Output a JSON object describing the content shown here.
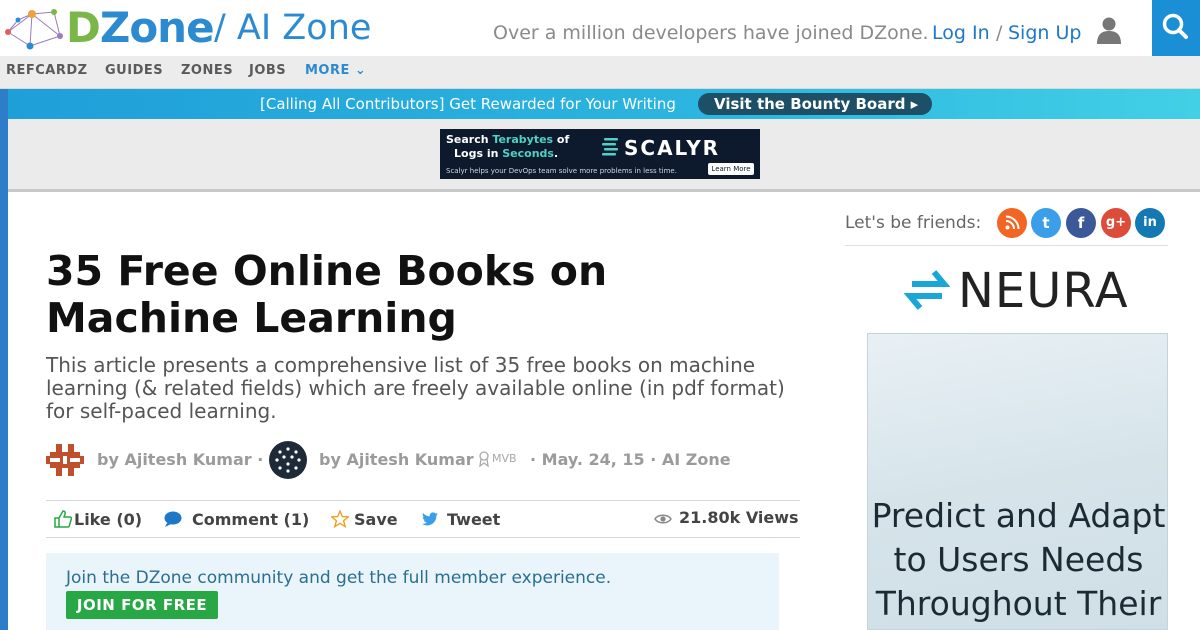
{
  "header": {
    "logo_text_d": "D",
    "logo_text_rest": "Zone",
    "zone_title": "/ AI Zone",
    "tagline": "Over a million developers have joined DZone.",
    "login": "Log In",
    "separator": "/",
    "signup": "Sign Up"
  },
  "nav": {
    "items": [
      "REFCARDZ",
      "GUIDES",
      "ZONES",
      "JOBS"
    ],
    "more": "MORE ⌄"
  },
  "banner": {
    "text": "[Calling All Contributors] Get Rewarded for Your Writing",
    "button": "Visit the Bounty Board ▸"
  },
  "top_ad": {
    "line1_a": "Search ",
    "line1_b": "Terabytes",
    "line1_c": " of",
    "line2_a": "Logs in ",
    "line2_b": "Seconds",
    "line2_c": ".",
    "brand": "SCALYR",
    "footer": "Scalyr helps your DevOps team solve more problems in less time.",
    "cta": "Learn More"
  },
  "article": {
    "title": "35 Free Online Books on Machine Learning",
    "subtitle": "This article presents a comprehensive list of 35 free books on machine learning (& related fields) which are freely available online (in pdf format) for self-paced learning.",
    "author1": "by Ajitesh Kumar ·",
    "author2": "by Ajitesh Kumar",
    "badge": "MVB",
    "date_zone": "·  May. 24, 15 · AI Zone"
  },
  "actions": {
    "like": "Like (0)",
    "comment": "Comment (1)",
    "save": "Save",
    "tweet": "Tweet",
    "views": "21.80k Views"
  },
  "join": {
    "text": "Join the DZone community and get the full member experience.",
    "button": "JOIN FOR FREE"
  },
  "sidebar": {
    "friends_label": "Let's be friends:",
    "social": [
      {
        "name": "rss",
        "glyph": "◉",
        "color": "#f26522"
      },
      {
        "name": "twitter",
        "glyph": "t",
        "color": "#3b9ee8"
      },
      {
        "name": "facebook",
        "glyph": "f",
        "color": "#3b5998"
      },
      {
        "name": "google-plus",
        "glyph": "g+",
        "color": "#dd4b39"
      },
      {
        "name": "linkedin",
        "glyph": "in",
        "color": "#1479b3"
      }
    ],
    "neura_brand": "NEURA",
    "neura_ad_text": "Predict and Adapt to Users Needs Throughout Their"
  },
  "colors": {
    "accent": "#2c8bd0",
    "brand_green": "#7ab648",
    "search_blue": "#1a8fd6",
    "join_green": "#27a845"
  }
}
